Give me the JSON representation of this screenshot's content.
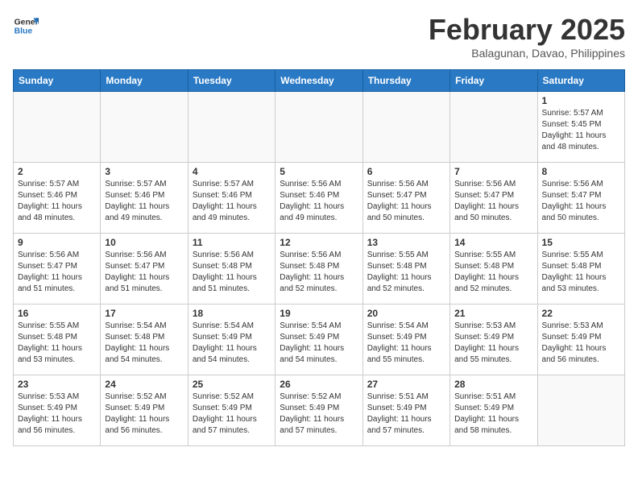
{
  "header": {
    "logo_line1": "General",
    "logo_line2": "Blue",
    "month_year": "February 2025",
    "location": "Balagunan, Davao, Philippines"
  },
  "weekdays": [
    "Sunday",
    "Monday",
    "Tuesday",
    "Wednesday",
    "Thursday",
    "Friday",
    "Saturday"
  ],
  "weeks": [
    [
      {
        "day": "",
        "info": ""
      },
      {
        "day": "",
        "info": ""
      },
      {
        "day": "",
        "info": ""
      },
      {
        "day": "",
        "info": ""
      },
      {
        "day": "",
        "info": ""
      },
      {
        "day": "",
        "info": ""
      },
      {
        "day": "1",
        "info": "Sunrise: 5:57 AM\nSunset: 5:45 PM\nDaylight: 11 hours\nand 48 minutes."
      }
    ],
    [
      {
        "day": "2",
        "info": "Sunrise: 5:57 AM\nSunset: 5:46 PM\nDaylight: 11 hours\nand 48 minutes."
      },
      {
        "day": "3",
        "info": "Sunrise: 5:57 AM\nSunset: 5:46 PM\nDaylight: 11 hours\nand 49 minutes."
      },
      {
        "day": "4",
        "info": "Sunrise: 5:57 AM\nSunset: 5:46 PM\nDaylight: 11 hours\nand 49 minutes."
      },
      {
        "day": "5",
        "info": "Sunrise: 5:56 AM\nSunset: 5:46 PM\nDaylight: 11 hours\nand 49 minutes."
      },
      {
        "day": "6",
        "info": "Sunrise: 5:56 AM\nSunset: 5:47 PM\nDaylight: 11 hours\nand 50 minutes."
      },
      {
        "day": "7",
        "info": "Sunrise: 5:56 AM\nSunset: 5:47 PM\nDaylight: 11 hours\nand 50 minutes."
      },
      {
        "day": "8",
        "info": "Sunrise: 5:56 AM\nSunset: 5:47 PM\nDaylight: 11 hours\nand 50 minutes."
      }
    ],
    [
      {
        "day": "9",
        "info": "Sunrise: 5:56 AM\nSunset: 5:47 PM\nDaylight: 11 hours\nand 51 minutes."
      },
      {
        "day": "10",
        "info": "Sunrise: 5:56 AM\nSunset: 5:47 PM\nDaylight: 11 hours\nand 51 minutes."
      },
      {
        "day": "11",
        "info": "Sunrise: 5:56 AM\nSunset: 5:48 PM\nDaylight: 11 hours\nand 51 minutes."
      },
      {
        "day": "12",
        "info": "Sunrise: 5:56 AM\nSunset: 5:48 PM\nDaylight: 11 hours\nand 52 minutes."
      },
      {
        "day": "13",
        "info": "Sunrise: 5:55 AM\nSunset: 5:48 PM\nDaylight: 11 hours\nand 52 minutes."
      },
      {
        "day": "14",
        "info": "Sunrise: 5:55 AM\nSunset: 5:48 PM\nDaylight: 11 hours\nand 52 minutes."
      },
      {
        "day": "15",
        "info": "Sunrise: 5:55 AM\nSunset: 5:48 PM\nDaylight: 11 hours\nand 53 minutes."
      }
    ],
    [
      {
        "day": "16",
        "info": "Sunrise: 5:55 AM\nSunset: 5:48 PM\nDaylight: 11 hours\nand 53 minutes."
      },
      {
        "day": "17",
        "info": "Sunrise: 5:54 AM\nSunset: 5:48 PM\nDaylight: 11 hours\nand 54 minutes."
      },
      {
        "day": "18",
        "info": "Sunrise: 5:54 AM\nSunset: 5:49 PM\nDaylight: 11 hours\nand 54 minutes."
      },
      {
        "day": "19",
        "info": "Sunrise: 5:54 AM\nSunset: 5:49 PM\nDaylight: 11 hours\nand 54 minutes."
      },
      {
        "day": "20",
        "info": "Sunrise: 5:54 AM\nSunset: 5:49 PM\nDaylight: 11 hours\nand 55 minutes."
      },
      {
        "day": "21",
        "info": "Sunrise: 5:53 AM\nSunset: 5:49 PM\nDaylight: 11 hours\nand 55 minutes."
      },
      {
        "day": "22",
        "info": "Sunrise: 5:53 AM\nSunset: 5:49 PM\nDaylight: 11 hours\nand 56 minutes."
      }
    ],
    [
      {
        "day": "23",
        "info": "Sunrise: 5:53 AM\nSunset: 5:49 PM\nDaylight: 11 hours\nand 56 minutes."
      },
      {
        "day": "24",
        "info": "Sunrise: 5:52 AM\nSunset: 5:49 PM\nDaylight: 11 hours\nand 56 minutes."
      },
      {
        "day": "25",
        "info": "Sunrise: 5:52 AM\nSunset: 5:49 PM\nDaylight: 11 hours\nand 57 minutes."
      },
      {
        "day": "26",
        "info": "Sunrise: 5:52 AM\nSunset: 5:49 PM\nDaylight: 11 hours\nand 57 minutes."
      },
      {
        "day": "27",
        "info": "Sunrise: 5:51 AM\nSunset: 5:49 PM\nDaylight: 11 hours\nand 57 minutes."
      },
      {
        "day": "28",
        "info": "Sunrise: 5:51 AM\nSunset: 5:49 PM\nDaylight: 11 hours\nand 58 minutes."
      },
      {
        "day": "",
        "info": ""
      }
    ]
  ]
}
